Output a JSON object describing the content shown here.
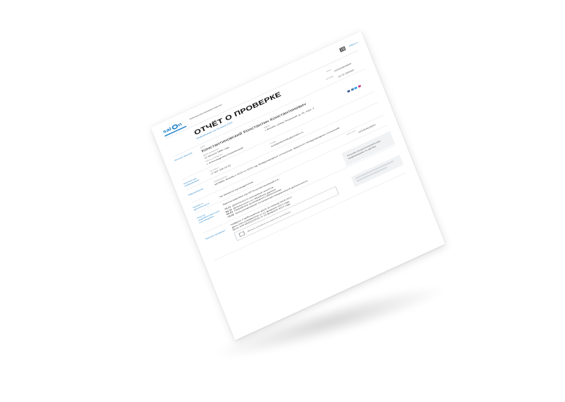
{
  "header": {
    "logo_text_1": "sal",
    "logo_text_2": "n",
    "subtitle": "Комплексная проверка персоны",
    "site": "saltbot.ru"
  },
  "title": "ОТЧЁТ О ПРОВЕРКЕ",
  "report_subtitle": "Информация на 19 июня 2023",
  "fields": {
    "inn_label": "ИНН",
    "inn_value": "222324624920",
    "person_label": "ФИО",
    "person_name": "Константиновский Константин Константинович",
    "snils_label": "СНИЛС",
    "snils_value": "12 01 262260",
    "birth_label": "Дата рождения",
    "birth_value": "12 августа 1986 года",
    "address_label": "Адрес",
    "address_value": "г. Москва, улица Ленинская, д. 32, корп. 3",
    "place_label": "Место рождения",
    "place_value": "г. Александровск-Сахалинский",
    "email_label": "Email",
    "email_value": "konstantinovsky@yandex.ru",
    "phone_label": "Телефон",
    "phone_value": "+7 927 345 34 03",
    "education_label": "Образование",
    "education_value": "МГИМО, Москва с 2010 по 2015 год. Международные отношения, факультет международных отношений",
    "work_value": "Не является руководителем",
    "ip_label": "ИНН ИП",
    "ip_value": "222324624920",
    "registry_value": "Зарегистрирован как ИП Константиновский К.К."
  },
  "sections": {
    "personal": "Личные данные",
    "contacts": "Контактная информация",
    "education": "Образование",
    "business": "Бизнес и деятельность",
    "registry": "Реестр недобросовестных поставщиков",
    "other": "Прочие проверки"
  },
  "activities": [
    {
      "code": "73.11",
      "text": "Деятельность рекламных агентств"
    },
    {
      "code": "63.11",
      "text": "Деятельность по обработке данных"
    },
    {
      "code": "62.01",
      "text": "Разработка программного обеспечения"
    },
    {
      "code": "70.22",
      "text": "Консультирование по вопросам коммерческой деятельности"
    }
  ],
  "court": {
    "line1": "Найдено 3 арбитражных дела за период 2015-2017",
    "line2": "Дело А40-123456/2016 от 12 февраля 2017 года",
    "line3": "Дело А40-654321/2016 от 15 февраля 2017 года"
  },
  "side_block": {
    "line1": "Ссылка на дополнительную",
    "line2": "информацию по делам"
  },
  "notice": {
    "text": "Данные получены из открытых источников"
  }
}
